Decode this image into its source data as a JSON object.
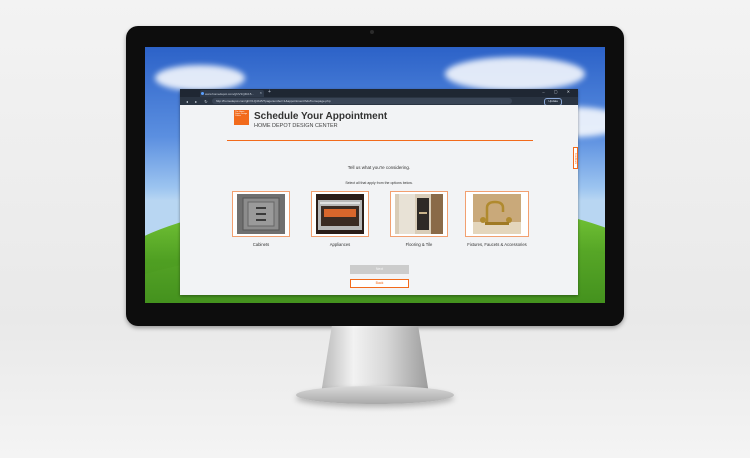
{
  "browser": {
    "tab_title": "www.homedepot.com/gh/V1Q4b15...",
    "new_tab": "+",
    "window_controls": "– ▢ ✕",
    "nav_icons": "◂ ▸ ↻ ⌂",
    "url": "http://homedepot.com/gh/V1Q4b15/?pagenumber=1&appointment/hdc/homepage.php",
    "update_label": "Update"
  },
  "page": {
    "logo_text": "The Home Depot Design Center",
    "title": "Schedule Your Appointment",
    "subtitle": "HOME DEPOT DESIGN CENTER",
    "feedback_tab": "Feedback",
    "prompt": "Tell us what you're considering.",
    "instruction": "Select all that apply from the options below.",
    "options": [
      {
        "label": "Cabinets"
      },
      {
        "label": "Appliances"
      },
      {
        "label": "Flooring & Tile"
      },
      {
        "label": "Fixtures, Faucets & Accessories"
      }
    ],
    "next_label": "Next",
    "back_label": "Back"
  },
  "colors": {
    "brand_orange": "#f26a1b",
    "browser_chrome": "#2a3442",
    "disabled_button": "#cccccc"
  }
}
